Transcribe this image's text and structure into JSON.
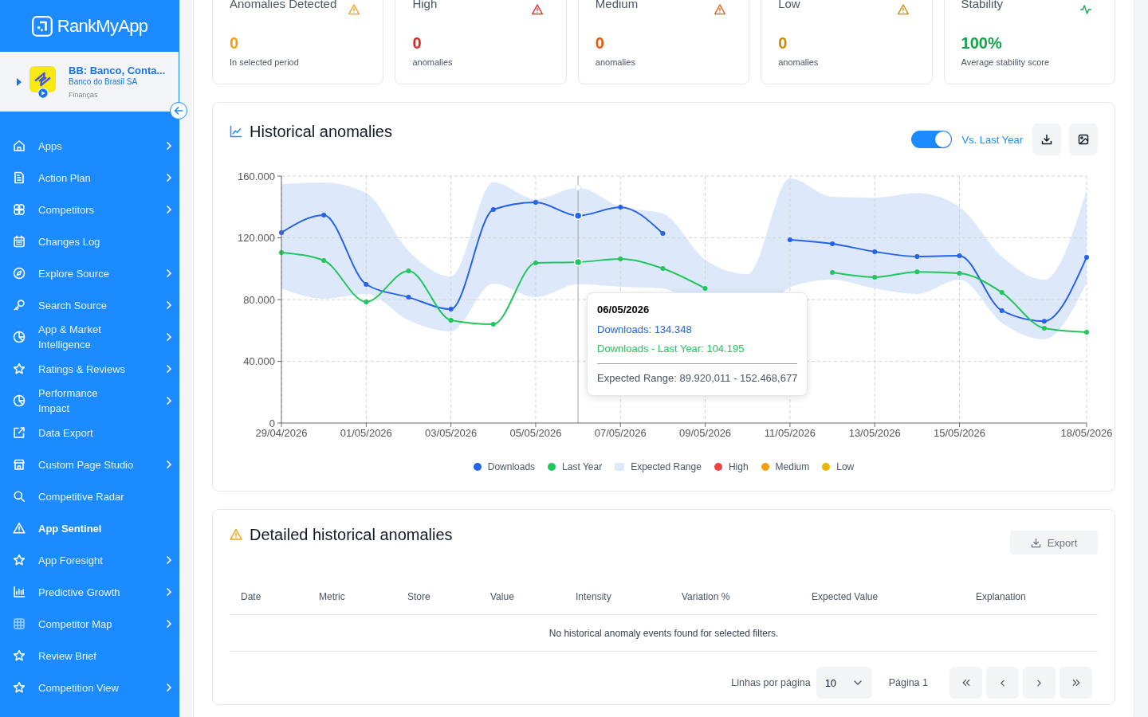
{
  "sidebar": {
    "logo": "RankMyApp",
    "app": {
      "name": "BB: Banco, Conta...",
      "developer": "Banco do Brasil SA",
      "category": "Finanças"
    },
    "items": [
      {
        "label": "Apps",
        "expandable": true,
        "selected": false
      },
      {
        "label": "Action Plan",
        "expandable": true,
        "selected": false
      },
      {
        "label": "Competitors",
        "expandable": true,
        "selected": false
      },
      {
        "label": "Changes Log",
        "expandable": false,
        "selected": false
      },
      {
        "label": "Explore Source",
        "expandable": true,
        "selected": false
      },
      {
        "label": "Search Source",
        "expandable": true,
        "selected": false
      },
      {
        "label": "App & Market\nIntelligence",
        "expandable": true,
        "selected": false
      },
      {
        "label": "Ratings & Reviews",
        "expandable": true,
        "selected": false
      },
      {
        "label": "Performance\nImpact",
        "expandable": true,
        "selected": false
      },
      {
        "label": "Data Export",
        "expandable": false,
        "selected": false
      },
      {
        "label": "Custom Page Studio",
        "expandable": true,
        "selected": false
      },
      {
        "label": "Competitive Radar",
        "expandable": false,
        "selected": false
      },
      {
        "label": "App Sentinel",
        "expandable": false,
        "selected": true
      },
      {
        "label": "App Foresight",
        "expandable": true,
        "selected": false
      },
      {
        "label": "Predictive Growth",
        "expandable": true,
        "selected": false
      },
      {
        "label": "Competitor Map",
        "expandable": true,
        "selected": false
      },
      {
        "label": "Review Brief",
        "expandable": false,
        "selected": false
      },
      {
        "label": "Competition View",
        "expandable": true,
        "selected": false
      }
    ]
  },
  "stats": [
    {
      "kind": "anomaly",
      "title": "Anomalies Detected",
      "value": "0",
      "caption": "In selected period",
      "color": "#f59e0b"
    },
    {
      "kind": "anomaly",
      "title": "High",
      "value": "0",
      "caption": "anomalies",
      "color": "#dc2626"
    },
    {
      "kind": "anomaly",
      "title": "Medium",
      "value": "0",
      "caption": "anomalies",
      "color": "#ea580c"
    },
    {
      "kind": "anomaly",
      "title": "Low",
      "value": "0",
      "caption": "anomalies",
      "color": "#ca8a04"
    },
    {
      "kind": "stability",
      "title": "Stability",
      "value": "100%",
      "caption": "Average stability score",
      "color": "#16a34a"
    }
  ],
  "history_chart": {
    "title": "Historical anomalies",
    "compare_toggle": {
      "label": "Vs. Last Year",
      "on": true
    },
    "chart_data": {
      "type": "line",
      "categories": [
        "29/04/2026",
        null,
        "01/05/2026",
        null,
        "03/05/2026",
        null,
        "05/05/2026",
        null,
        "07/05/2026",
        null,
        "09/05/2026",
        null,
        "11/05/2026",
        null,
        "13/05/2026",
        null,
        "15/05/2026",
        null,
        null,
        "18/05/2026"
      ],
      "ylim": [
        0,
        160000
      ],
      "yticks": [
        {
          "value": 0,
          "label": "0"
        },
        {
          "value": 40000,
          "label": "40.000"
        },
        {
          "value": 80000,
          "label": "80.000"
        },
        {
          "value": 120000,
          "label": "120.000"
        },
        {
          "value": 160000,
          "label": "160.000"
        }
      ],
      "grid": true,
      "series": [
        {
          "name": "Downloads",
          "color": "#2563eb",
          "marker": "circle",
          "values": [
            123400,
            134700,
            89800,
            81500,
            73800,
            138300,
            143000,
            134300,
            139900,
            122800,
            null,
            null,
            118700,
            116100,
            111000,
            107900,
            108400,
            72800,
            66000,
            107400
          ]
        },
        {
          "name": "Last Year",
          "color": "#22c55e",
          "marker": "circle",
          "values": [
            110500,
            105300,
            78500,
            98600,
            66600,
            64000,
            103700,
            104200,
            106300,
            100100,
            87200,
            null,
            null,
            97500,
            94500,
            98000,
            97000,
            84600,
            61400,
            58800
          ]
        }
      ]
    },
    "range_band": {
      "label": "Expected Range",
      "color": "#dde9fb"
    },
    "anomaly_markers": [
      {
        "label": "High",
        "color": "#ef4444"
      },
      {
        "label": "Medium",
        "color": "#f59e0b"
      },
      {
        "label": "Low",
        "color": "#eab308"
      }
    ],
    "tooltip": {
      "date": "06/05/2026",
      "lines": [
        {
          "text": "Downloads: 134.348",
          "color": "#2563eb"
        },
        {
          "text": "Downloads - Last Year: 104.195",
          "color": "#22c55e"
        }
      ],
      "range": "Expected Range: 89.920,011 - 152.468,677"
    }
  },
  "anomaly_table": {
    "title": "Detailed historical anomalies",
    "export_button": {
      "label": "Export",
      "disabled": true
    },
    "columns": [
      "Date",
      "Metric",
      "Store",
      "Value",
      "Intensity",
      "Variation %",
      "Expected Value",
      "Explanation"
    ],
    "empty_message": "No historical anomaly events found for selected filters.",
    "pagination": {
      "rows_label": "Linhas por página",
      "rows_per_page": "10",
      "page_label": "Página 1"
    }
  }
}
